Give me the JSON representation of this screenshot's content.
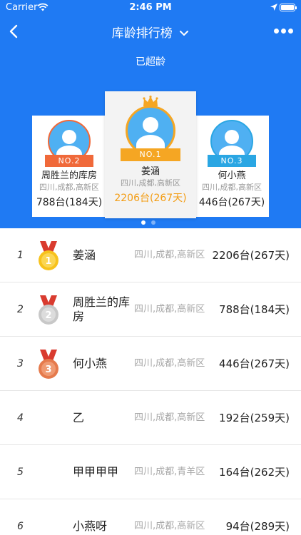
{
  "status_bar": {
    "carrier": "Carrier",
    "time": "2:46 PM"
  },
  "nav": {
    "title": "库龄排行榜"
  },
  "subtitle": "已超龄",
  "podium": {
    "first": {
      "badge": "NO.1",
      "name": "姜涵",
      "address": "四川,成都,高新区",
      "value": "2206台(267天)"
    },
    "second": {
      "badge": "NO.2",
      "name": "周胜兰的库房",
      "address": "四川,成都,高新区",
      "value": "788台(184天)"
    },
    "third": {
      "badge": "NO.3",
      "name": "何小燕",
      "address": "四川,成都,高新区",
      "value": "446台(267天)"
    }
  },
  "carousel": {
    "pages": 2,
    "active": 1
  },
  "rankings": [
    {
      "rank": "1",
      "name": "姜涵",
      "address": "四川,成都,高新区",
      "value": "2206台(267天)",
      "medal": "1"
    },
    {
      "rank": "2",
      "name": "周胜兰的库房",
      "address": "四川,成都,高新区",
      "value": "788台(184天)",
      "medal": "2"
    },
    {
      "rank": "3",
      "name": "何小燕",
      "address": "四川,成都,高新区",
      "value": "446台(267天)",
      "medal": "3"
    },
    {
      "rank": "4",
      "name": "乙",
      "address": "四川,成都,高新区",
      "value": "192台(259天)"
    },
    {
      "rank": "5",
      "name": "甲甲甲甲",
      "address": "四川,成都,青羊区",
      "value": "164台(262天)"
    },
    {
      "rank": "6",
      "name": "小燕呀",
      "address": "四川,成都,高新区",
      "value": "94台(289天)"
    }
  ],
  "icons": {
    "back": "chevron-left-icon",
    "title_dropdown": "chevron-down-icon",
    "more": "more-dots-icon",
    "crown": "crown-icon",
    "avatar": "user-avatar-icon",
    "medal": "medal-icon"
  },
  "colors": {
    "primary_blue": "#1f7af3",
    "gold": "#f5a623",
    "silver_ribbon": "#f0693a",
    "bronze_ribbon": "#2aa6e3",
    "first_value": "#f39c12",
    "medal_gold": "#f7c21c",
    "medal_silver": "#c8c8c8",
    "medal_bronze": "#e57a4c",
    "medal_strap": "#d93b2f"
  }
}
